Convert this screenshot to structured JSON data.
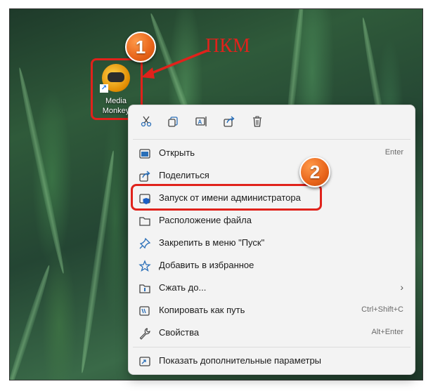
{
  "desktop": {
    "icon": {
      "name": "Media Monkey",
      "line1": "Media",
      "line2": "Monkey"
    }
  },
  "annotations": {
    "badge1": "1",
    "badge2": "2",
    "label": "ПКМ",
    "accent_color": "#e0221b"
  },
  "context_menu": {
    "toolbar": [
      "cut-icon",
      "copy-icon",
      "rename-icon",
      "share-icon",
      "delete-icon"
    ],
    "items": [
      {
        "label": "Открыть",
        "shortcut": "Enter",
        "icon": "open-icon"
      },
      {
        "label": "Поделиться",
        "shortcut": "",
        "icon": "share-icon"
      },
      {
        "label": "Запуск от имени администратора",
        "shortcut": "",
        "icon": "shield-icon"
      },
      {
        "label": "Расположение файла",
        "shortcut": "",
        "icon": "folder-icon"
      },
      {
        "label": "Закрепить в меню \"Пуск\"",
        "shortcut": "",
        "icon": "pin-icon"
      },
      {
        "label": "Добавить в избранное",
        "shortcut": "",
        "icon": "star-icon"
      },
      {
        "label": "Сжать до...",
        "shortcut": "",
        "icon": "zip-icon",
        "submenu": true
      },
      {
        "label": "Копировать как путь",
        "shortcut": "Ctrl+Shift+C",
        "icon": "copy-path-icon"
      },
      {
        "label": "Свойства",
        "shortcut": "Alt+Enter",
        "icon": "wrench-icon"
      },
      {
        "label": "Показать дополнительные параметры",
        "shortcut": "",
        "icon": "more-options-icon"
      }
    ]
  }
}
